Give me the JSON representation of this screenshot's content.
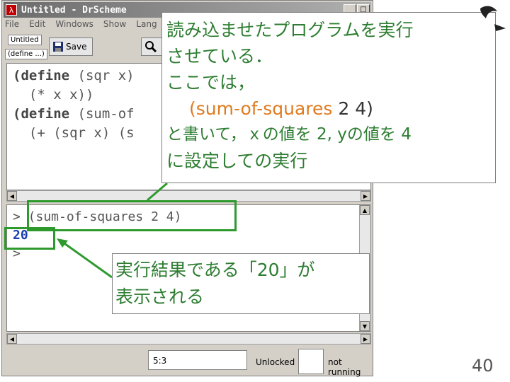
{
  "window": {
    "title": "Untitled - DrScheme",
    "min_glyph": "_",
    "max_glyph": "□",
    "close_glyph": "×",
    "app_icon_glyph": "λ"
  },
  "menu": [
    "File",
    "Edit",
    "Windows",
    "Show",
    "Lang"
  ],
  "toolbar": {
    "name_button": "Untitled",
    "define_menu": "(define ...)",
    "save_label": "Save"
  },
  "editor": {
    "lines": [
      {
        "kw": "(define",
        "rest": " (sqr x)"
      },
      {
        "kw": "",
        "rest": "  (* x x))"
      },
      {
        "kw": "(define",
        "rest": " (sum-of"
      },
      {
        "kw": "",
        "rest": "  (+ (sqr x) (s"
      }
    ]
  },
  "interactions": {
    "line1": "> (sum-of-squares 2 4)",
    "result": "20",
    "line3": ">"
  },
  "status": {
    "position": "5:3",
    "lock": "Unlocked",
    "running": "not running"
  },
  "callout_top": {
    "line1": "読み込ませたプログラムを実行",
    "line2": "させている．",
    "line3": "ここでは，",
    "code": "(sum-of-squares ",
    "code_args": "2 4)",
    "line5": "と書いて，ｘの値を 2, yの値を 4",
    "line6": "に設定しての実行"
  },
  "callout_bottom": {
    "line1": "実行結果である「20」が",
    "line2": "表示される"
  },
  "page_number": "40",
  "colors": {
    "highlight": "#2e9a2e",
    "annotation_text": "#2e7d32",
    "code_orange": "#e07b20"
  }
}
